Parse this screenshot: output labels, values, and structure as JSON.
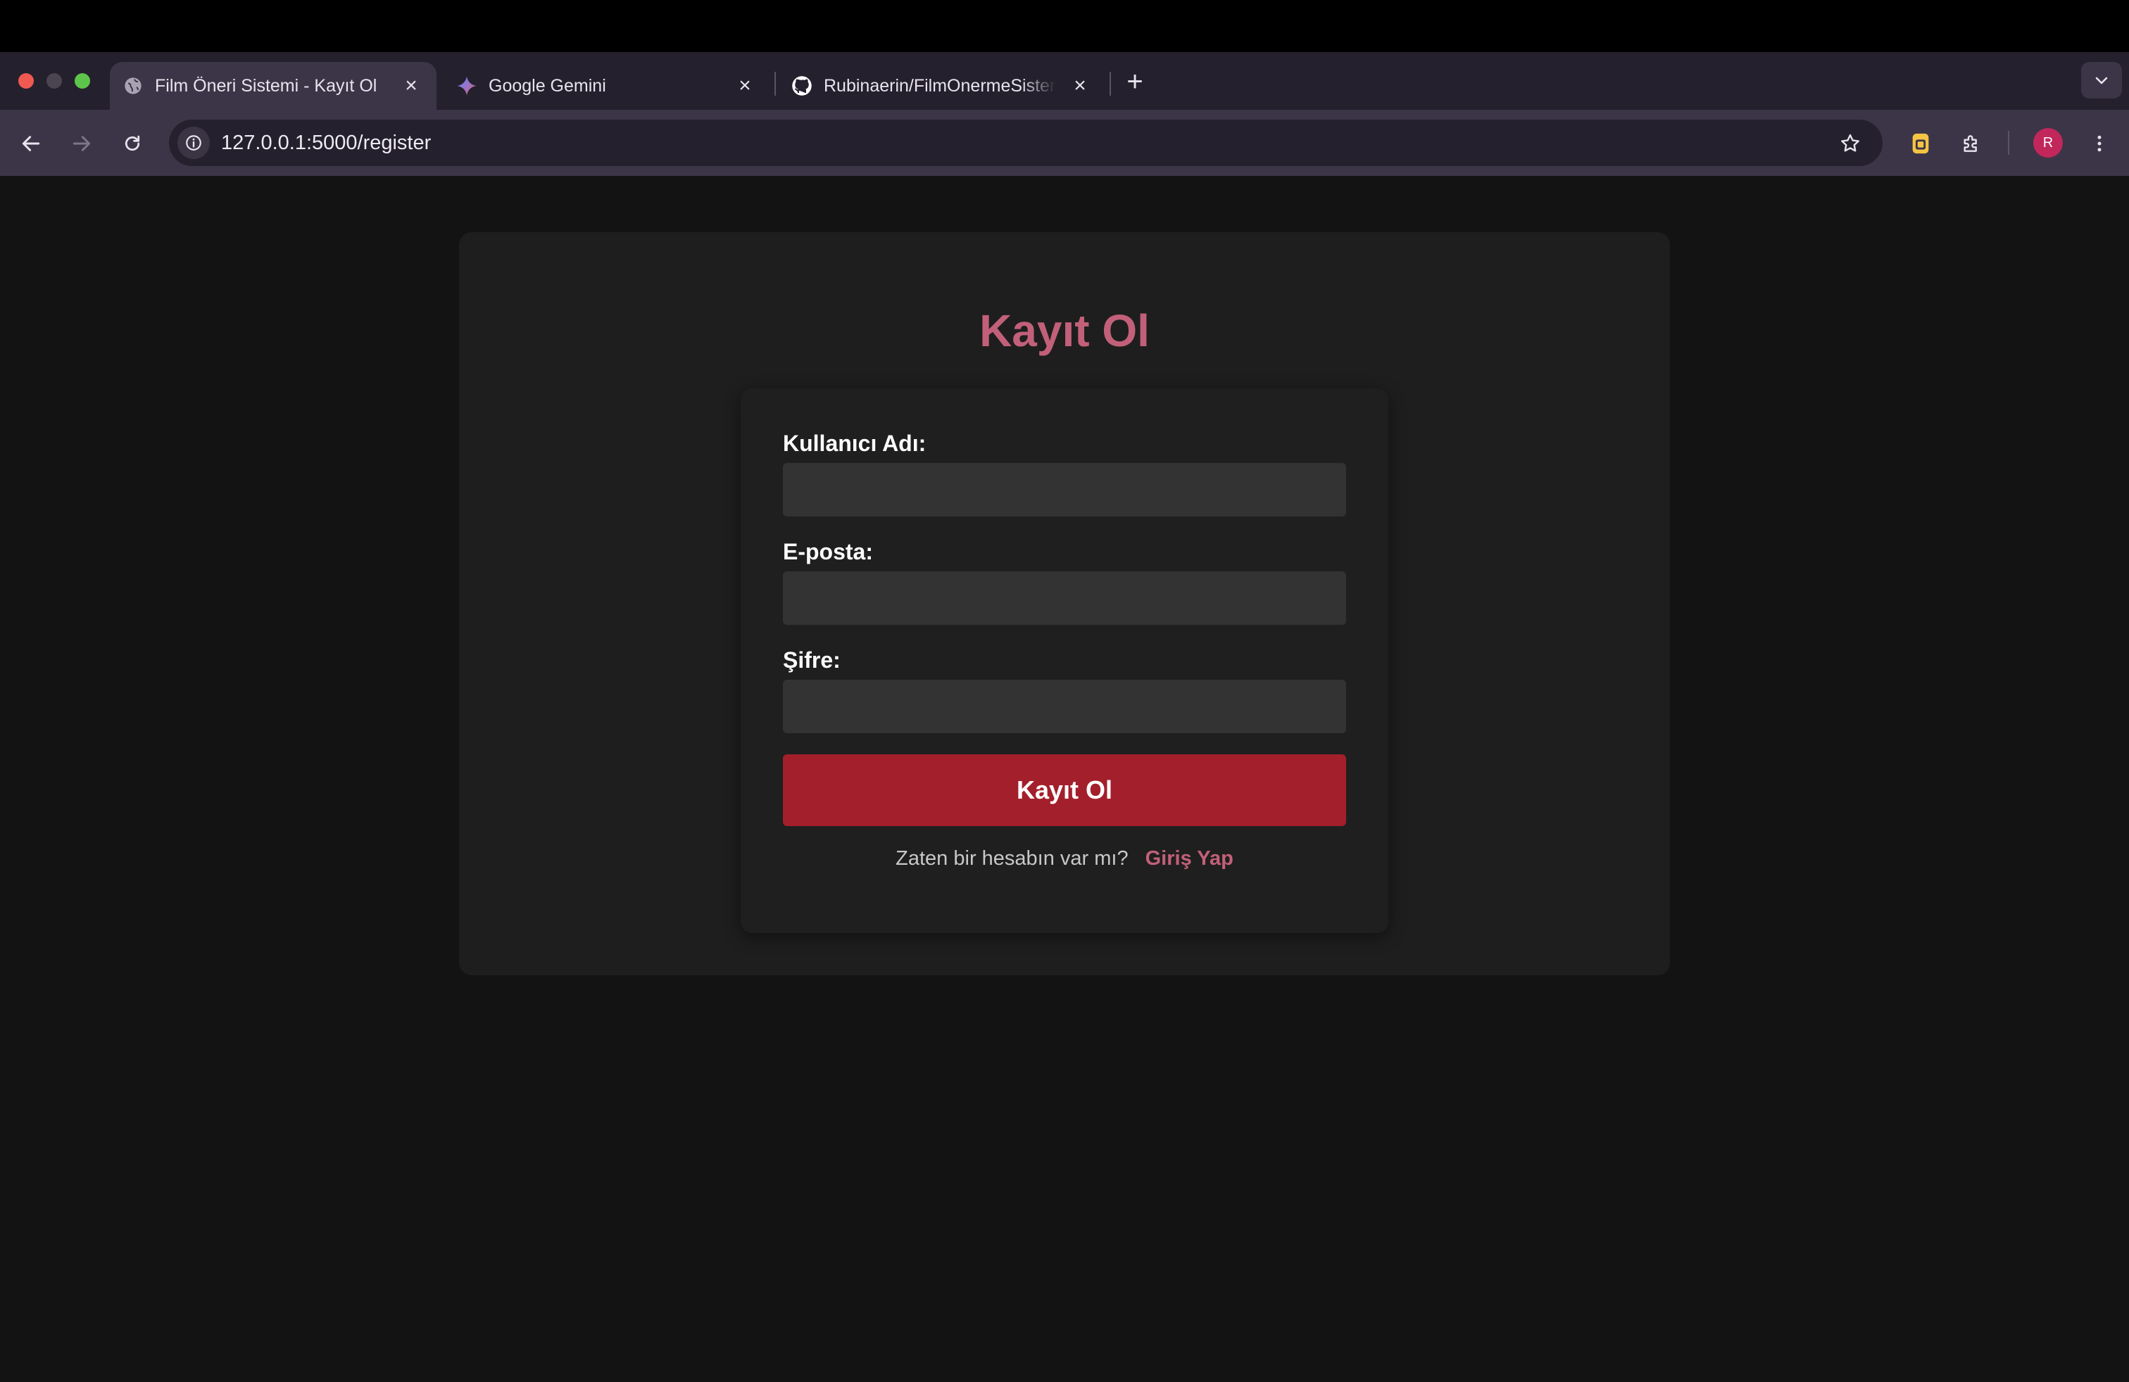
{
  "browser": {
    "tabs": [
      {
        "title": "Film Öneri Sistemi - Kayıt Ol",
        "favicon": "globe-icon",
        "active": true
      },
      {
        "title": "Google Gemini",
        "favicon": "gemini-sparkle-icon",
        "active": false
      },
      {
        "title": "Rubinaerin/FilmOnermeSistemi",
        "favicon": "github-icon",
        "active": false
      }
    ],
    "url": "127.0.0.1:5000/register",
    "profile_initial": "R",
    "colors": {
      "tabstrip": "#25202d",
      "toolbar": "#3c3547",
      "profile": "#c1275a",
      "extension": "#f6c445"
    }
  },
  "page": {
    "title": "Kayıt Ol",
    "fields": [
      {
        "label": "Kullanıcı Adı:",
        "value": ""
      },
      {
        "label": "E-posta:",
        "value": ""
      },
      {
        "label": "Şifre:",
        "value": ""
      }
    ],
    "submit_label": "Kayıt Ol",
    "footer": {
      "question": "Zaten bir hesabın var mı?",
      "link_label": "Giriş Yap"
    },
    "colors": {
      "accent": "#c2607a",
      "button": "#a31f2b",
      "background": "#131313",
      "card": "#1e1e1e",
      "input": "#333333"
    }
  }
}
